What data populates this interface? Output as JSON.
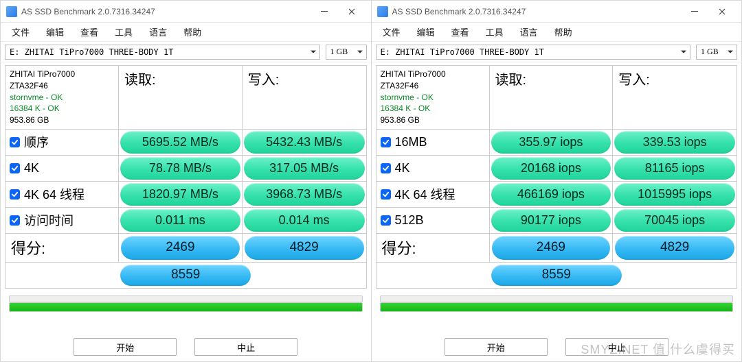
{
  "app_title": "AS SSD Benchmark 2.0.7316.34247",
  "menus": {
    "file": "文件",
    "edit": "编辑",
    "view": "查看",
    "tools": "工具",
    "lang": "语言",
    "help": "帮助"
  },
  "drive_select": "E: ZHITAI TiPro7000 THREE-BODY 1T",
  "size_select": "1 GB",
  "drive_info": {
    "model": "ZHITAI TiPro7000",
    "fw": "ZTA32F46",
    "driver": "stornvme - OK",
    "align": "16384 K - OK",
    "capacity": "953.86 GB"
  },
  "columns": {
    "read": "读取:",
    "write": "写入:"
  },
  "left_tests": [
    {
      "label": "顺序",
      "read": "5695.52 MB/s",
      "write": "5432.43 MB/s"
    },
    {
      "label": "4K",
      "read": "78.78 MB/s",
      "write": "317.05 MB/s"
    },
    {
      "label": "4K 64 线程",
      "read": "1820.97 MB/s",
      "write": "3968.73 MB/s"
    },
    {
      "label": "访问时间",
      "read": "0.011 ms",
      "write": "0.014 ms"
    }
  ],
  "right_tests": [
    {
      "label": "16MB",
      "read": "355.97 iops",
      "write": "339.53 iops"
    },
    {
      "label": "4K",
      "read": "20168 iops",
      "write": "81165 iops"
    },
    {
      "label": "4K 64 线程",
      "read": "466169 iops",
      "write": "1015995 iops"
    },
    {
      "label": "512B",
      "read": "90177 iops",
      "write": "70045 iops"
    }
  ],
  "score": {
    "label": "得分:",
    "read": "2469",
    "write": "4829",
    "total": "8559"
  },
  "buttons": {
    "start": "开始",
    "abort": "中止"
  },
  "watermark": "SMYZ.NET  值  什么虞得买"
}
